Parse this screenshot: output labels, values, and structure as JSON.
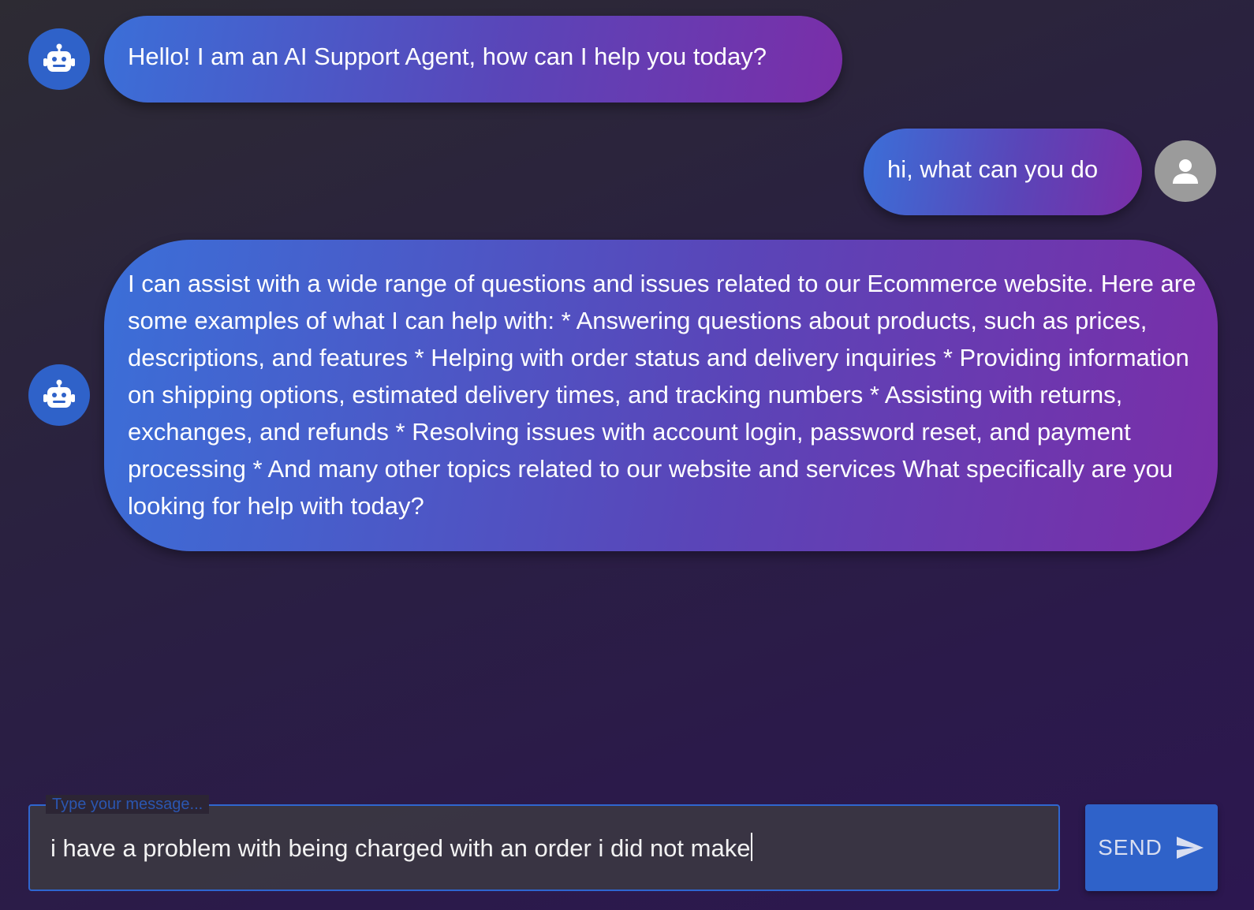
{
  "conversation": {
    "messages": [
      {
        "role": "bot",
        "avatar_icon": "robot-icon",
        "text": "Hello! I am an AI Support Agent, how can I help you today?"
      },
      {
        "role": "user",
        "avatar_icon": "person-icon",
        "text": "hi, what can you do"
      },
      {
        "role": "bot",
        "avatar_icon": "robot-icon",
        "text": "I can assist with a wide range of questions and issues related to our Ecommerce website. Here are some examples of what I can help with: * Answering questions about products, such as prices, descriptions, and features * Helping with order status and delivery inquiries * Providing information on shipping options, estimated delivery times, and tracking numbers * Assisting with returns, exchanges, and refunds * Resolving issues with account login, password reset, and payment processing * And many other topics related to our website and services What specifically are you looking for help with today?"
      }
    ]
  },
  "composer": {
    "label": "Type your message...",
    "value": "i have a problem with being charged with an order i did not make",
    "send_label": "SEND",
    "send_icon": "send-icon"
  },
  "colors": {
    "accent": "#2f62c9",
    "bubble_start": "#3b6fd8",
    "bubble_end": "#7a2ea8",
    "user_avatar": "#9b9b9b"
  }
}
